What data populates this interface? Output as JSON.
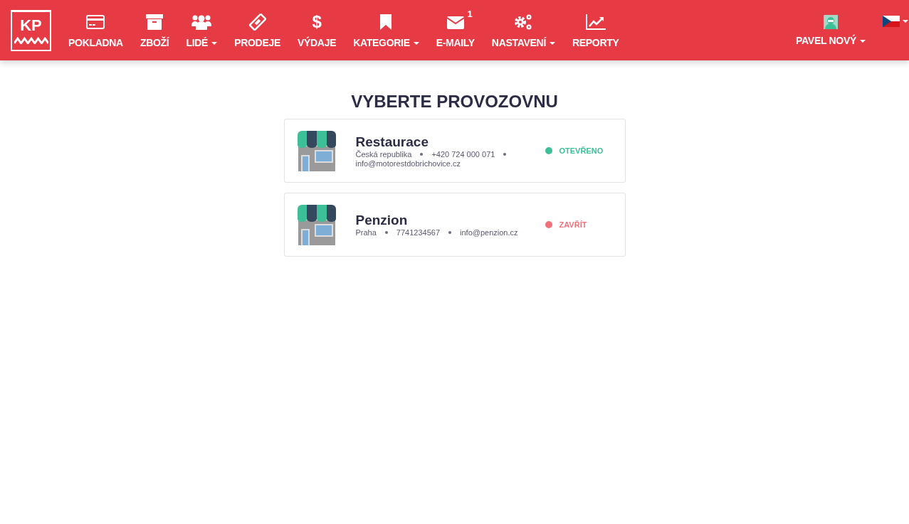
{
  "logo": {
    "text": "KP"
  },
  "nav": [
    {
      "kind": "card",
      "label": "POKLADNA",
      "dropdown": false
    },
    {
      "kind": "box",
      "label": "ZBOŽÍ",
      "dropdown": false
    },
    {
      "kind": "people",
      "label": "LIDÉ",
      "dropdown": true
    },
    {
      "kind": "ticket",
      "label": "PRODEJE",
      "dropdown": false
    },
    {
      "kind": "glyph",
      "glyph": "$",
      "label": "VÝDAJE",
      "dropdown": false
    },
    {
      "kind": "bookmark",
      "label": "KATEGORIE",
      "dropdown": true
    },
    {
      "kind": "mail",
      "label": "E-MAILY",
      "badge": "1",
      "dropdown": false
    },
    {
      "kind": "gears",
      "label": "NASTAVENÍ",
      "dropdown": true
    },
    {
      "kind": "chart",
      "label": "REPORTY",
      "dropdown": false
    }
  ],
  "user": {
    "name": "PAVEL NOVÝ",
    "dropdown": true
  },
  "language": {
    "dropdown": true
  },
  "heading": "VYBERTE PROVOZOVNU",
  "venues": [
    {
      "name": "Restaurace",
      "details": [
        "Česká republika",
        "+420 724 000 071",
        "info@motorestdobrichovice.cz"
      ],
      "status": "OTEVŘENO",
      "color": "#3dbf97"
    },
    {
      "name": "Penzion",
      "details": [
        "Praha",
        "7741234567",
        "info@penzion.cz"
      ],
      "status": "ZAVŘÍT",
      "color": "#f0717a"
    }
  ]
}
